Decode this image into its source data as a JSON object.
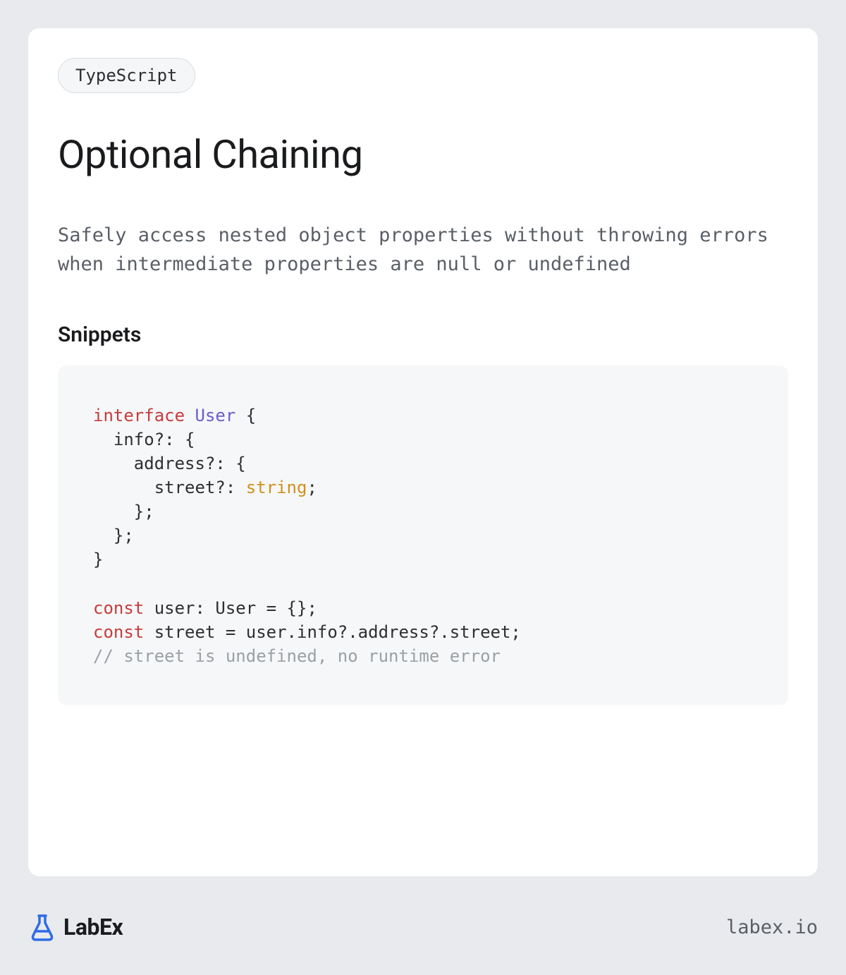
{
  "tag": "TypeScript",
  "title": "Optional Chaining",
  "description": "Safely access nested object properties without throwing errors when intermediate properties are null or undefined",
  "snippets_heading": "Snippets",
  "code": {
    "tokens": [
      {
        "text": "interface",
        "cls": "kw-interface"
      },
      {
        "text": " ",
        "cls": ""
      },
      {
        "text": "User",
        "cls": "type-name"
      },
      {
        "text": " {\n  info?: {\n    address?: {\n      street?: ",
        "cls": ""
      },
      {
        "text": "string",
        "cls": "prim-type"
      },
      {
        "text": ";\n    };\n  };\n}\n\n",
        "cls": ""
      },
      {
        "text": "const",
        "cls": "kw-const"
      },
      {
        "text": " user: User = {};\n",
        "cls": ""
      },
      {
        "text": "const",
        "cls": "kw-const"
      },
      {
        "text": " street = user.info?.address?.street;\n",
        "cls": ""
      },
      {
        "text": "// street is undefined, no runtime error",
        "cls": "comment"
      }
    ]
  },
  "brand": "LabEx",
  "site": "labex.io",
  "colors": {
    "accent_blue": "#2e6be6"
  }
}
